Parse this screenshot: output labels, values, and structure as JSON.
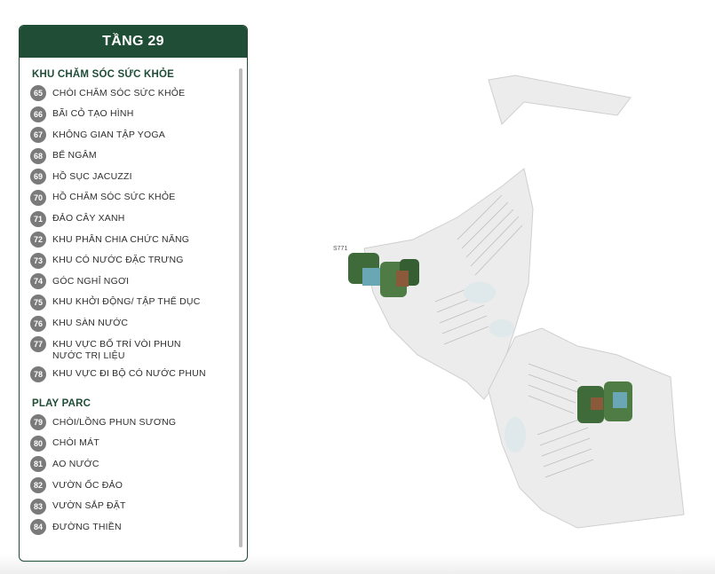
{
  "panel": {
    "title": "TẦNG 29",
    "sections": [
      {
        "title": "KHU CHĂM SÓC SỨC KHỎE",
        "items": [
          {
            "num": "65",
            "label": "CHÒI CHĂM SÓC SỨC KHỎE"
          },
          {
            "num": "66",
            "label": "BÃI CỎ TẠO HÌNH"
          },
          {
            "num": "67",
            "label": "KHÔNG GIAN TẬP YOGA"
          },
          {
            "num": "68",
            "label": "BỂ NGÂM"
          },
          {
            "num": "69",
            "label": "HỒ SỤC JACUZZI"
          },
          {
            "num": "70",
            "label": "HỒ CHĂM SÓC SỨC KHỎE"
          },
          {
            "num": "71",
            "label": "ĐẢO CÂY XANH"
          },
          {
            "num": "72",
            "label": "KHU PHÂN CHIA CHỨC NĂNG"
          },
          {
            "num": "73",
            "label": "KHU CÓ NƯỚC ĐẶC TRƯNG"
          },
          {
            "num": "74",
            "label": "GÓC NGHỈ NGƠI"
          },
          {
            "num": "75",
            "label": "KHU KHỞI ĐỘNG/ TẬP THỂ DỤC"
          },
          {
            "num": "76",
            "label": "KHU SÀN NƯỚC"
          },
          {
            "num": "77",
            "label": "KHU VỰC BỐ TRÍ VÒI PHUN NƯỚC TRỊ LIỆU"
          },
          {
            "num": "78",
            "label": "KHU VỰC ĐI BỘ CÓ NƯỚC PHUN"
          }
        ]
      },
      {
        "title": "PLAY PARC",
        "items": [
          {
            "num": "79",
            "label": "CHÒI/LỒNG PHUN SƯƠNG"
          },
          {
            "num": "80",
            "label": "CHÒI MÁT"
          },
          {
            "num": "81",
            "label": "AO NƯỚC"
          },
          {
            "num": "82",
            "label": "VƯỜN ỐC ĐẢO"
          },
          {
            "num": "83",
            "label": "VƯỜN SẮP ĐẶT"
          },
          {
            "num": "84",
            "label": "ĐƯỜNG THIỀN"
          }
        ]
      }
    ]
  },
  "map": {
    "label": "S771"
  },
  "colors": {
    "brand_green": "#1f4d36",
    "badge_gray": "#7a7a7a"
  }
}
